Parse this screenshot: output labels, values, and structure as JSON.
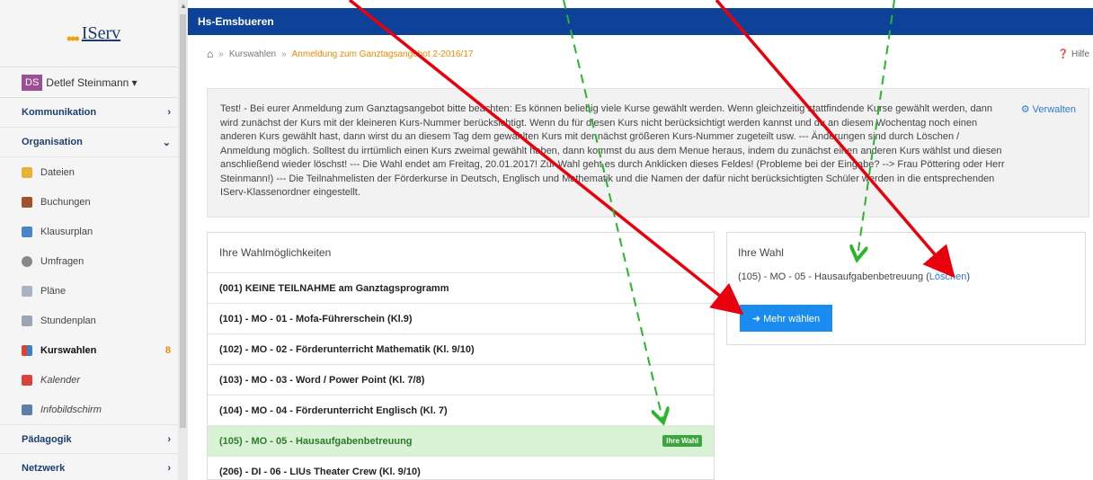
{
  "logo": {
    "dots": "•••",
    "brand": "IServ"
  },
  "user": {
    "initials": "DS",
    "name": "Detlef Steinmann ▾"
  },
  "sidebar": {
    "sections": [
      {
        "label": "Kommunikation",
        "chevron": "›"
      },
      {
        "label": "Organisation",
        "chevron": "⌄"
      }
    ],
    "items": [
      {
        "label": "Dateien",
        "icon": "folder-icon",
        "color": "#e7b23b"
      },
      {
        "label": "Buchungen",
        "icon": "book-icon",
        "color": "#a0522d"
      },
      {
        "label": "Klausurplan",
        "icon": "calendar-icon",
        "color": "#4a86c5"
      },
      {
        "label": "Umfragen",
        "icon": "survey-icon",
        "color": "#888888"
      },
      {
        "label": "Pläne",
        "icon": "document-icon",
        "color": "#a8b3c4"
      },
      {
        "label": "Stundenplan",
        "icon": "timetable-icon",
        "color": "#9aa6b6"
      },
      {
        "label": "Kurswahlen",
        "icon": "blocks-icon",
        "color": "#d9433a",
        "badge": "8"
      },
      {
        "label": "Kalender",
        "icon": "calendar-red-icon",
        "color": "#d9433a"
      },
      {
        "label": "Infobildschirm",
        "icon": "monitor-icon",
        "color": "#5b7fa8"
      }
    ],
    "bottom": [
      {
        "label": "Pädagogik",
        "chevron": "›"
      },
      {
        "label": "Netzwerk",
        "chevron": "›"
      }
    ]
  },
  "header": {
    "title": "Hs-Emsbueren"
  },
  "breadcrumb": {
    "home_icon": "home-icon",
    "separator": "»",
    "item1": "Kurswahlen",
    "current": "Anmeldung zum Ganztagsangebot 2-2016/17",
    "help": "❓ Hilfe"
  },
  "notice": {
    "text": "Test! - Bei eurer Anmeldung zum Ganztagsangebot bitte beachten: Es können beliebig viele Kurse gewählt werden. Wenn gleichzeitig stattfindende Kurse gewählt werden, dann wird zunächst der Kurs mit der kleineren Kurs-Nummer berücksichtigt. Wenn du für diesen Kurs nicht berücksichtigt werden kannst und du an diesem Wochentag noch einen anderen Kurs gewählt hast, dann wirst du an diesem Tag dem gewählten Kurs mit der nächst größeren Kurs-Nummer zugeteilt usw. --- Änderungen sind durch Löschen / Anmeldung möglich. Solltest du irrtümlich einen Kurs zweimal gewählt haben, dann kommst du aus dem Menue heraus, indem du zunächst einen anderen Kurs wählst und diesen anschließend wieder löschst! --- Die Wahl endet am Freitag, 20.01.2017! Zur Wahl geht es durch Anklicken dieses Feldes! (Probleme bei der Eingabe? --> Frau Pöttering oder Herr Steinmann!) --- Die Teilnahmelisten der Förderkurse in Deutsch, Englisch und Mathematik und die Namen der dafür nicht berücksichtigten Schüler werden in die entsprechenden IServ-Klassenordner eingestellt.",
    "manage": "⚙ Verwalten"
  },
  "choices": {
    "title": "Ihre Wahlmöglichkeiten",
    "rows": [
      "(001) KEINE TEILNAHME am Ganztagsprogramm",
      "(101) - MO - 01 - Mofa-Führerschein (Kl.9)",
      "(102) - MO - 02 - Förderunterricht Mathematik (Kl. 9/10)",
      "(103) - MO - 03 - Word / Power Point (Kl. 7/8)",
      "(104) - MO - 04 - Förderunterricht Englisch (Kl. 7)",
      "(105) - MO - 05 - Hausaufgabenbetreuung",
      "(206) - DI - 06 - LIUs Theater Crew (Kl. 9/10)"
    ],
    "selected_tag": "Ihre Wahl"
  },
  "mine": {
    "title": "Ihre Wahl",
    "entry": "(105) - MO - 05 - Hausaufgabenbetreuung (",
    "delete": "Löschen",
    "close": ")",
    "more_button": "➜  Mehr wählen"
  },
  "annotations": {
    "red": "#e8000d",
    "green": "#2bb52b"
  }
}
